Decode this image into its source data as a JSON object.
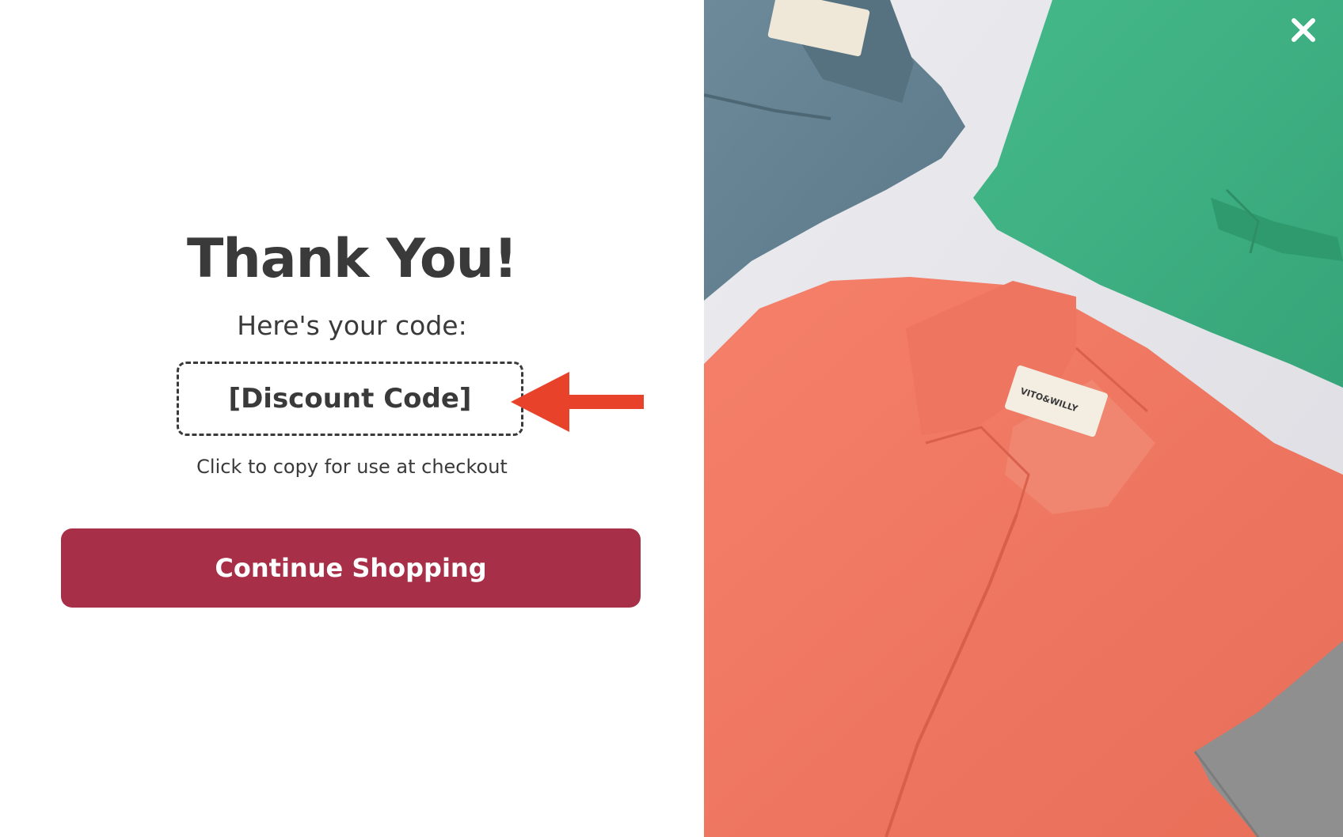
{
  "modal": {
    "title": "Thank You!",
    "subtitle": "Here's your code:",
    "discount_code": "[Discount Code]",
    "copy_hint": "Click to copy for use at checkout",
    "cta_label": "Continue Shopping"
  },
  "product_image": {
    "description": "folded polo shirts in blue-grey, green, coral and grey",
    "label_text": "VITO&WILLY"
  },
  "icons": {
    "close": "close-icon",
    "arrow": "arrow-left-icon"
  },
  "colors": {
    "title_text": "#3a3a3a",
    "cta_background": "#a73048",
    "cta_text": "#ffffff",
    "arrow": "#e8432a",
    "close_icon": "#ffffff"
  }
}
